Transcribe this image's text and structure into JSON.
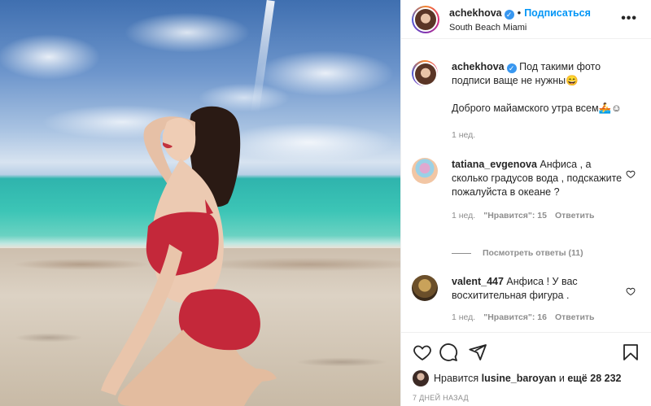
{
  "post": {
    "author": "achekhova",
    "follow_label": "Подписаться",
    "location": "South Beach Miami",
    "more_label": "•••",
    "caption_line1": "Под такими фото подписи ваще не нужны😄",
    "caption_line2": "Доброго майамского утра всем🚣☺",
    "caption_time": "1 нед."
  },
  "comments": [
    {
      "user": "tatiana_evgenova",
      "text": "Анфиса , а сколько градусов вода , подскажите пожалуйста в океане ?",
      "time": "1 нед.",
      "likes": "\"Нравится\": 15",
      "reply": "Ответить"
    },
    {
      "user": "valent_447",
      "text": "Анфиса ! У вас восхитительная фигура .",
      "time": "1 нед.",
      "likes": "\"Нравится\": 16",
      "reply": "Ответить"
    }
  ],
  "view_replies": "Посмотреть ответы (11)",
  "likes_bar": {
    "prefix": "Нравится",
    "user": "lusine_baroyan",
    "suffix_and": "и",
    "suffix_count": "ещё 28 232"
  },
  "date": "7 ДНЕЙ НАЗАД",
  "colors": {
    "link": "#0095f6",
    "verified": "#3897f0",
    "muted": "#8e8e8e"
  },
  "icons": [
    "heart-icon",
    "comment-icon",
    "share-icon",
    "bookmark-icon",
    "verified-badge-icon",
    "more-icon"
  ]
}
